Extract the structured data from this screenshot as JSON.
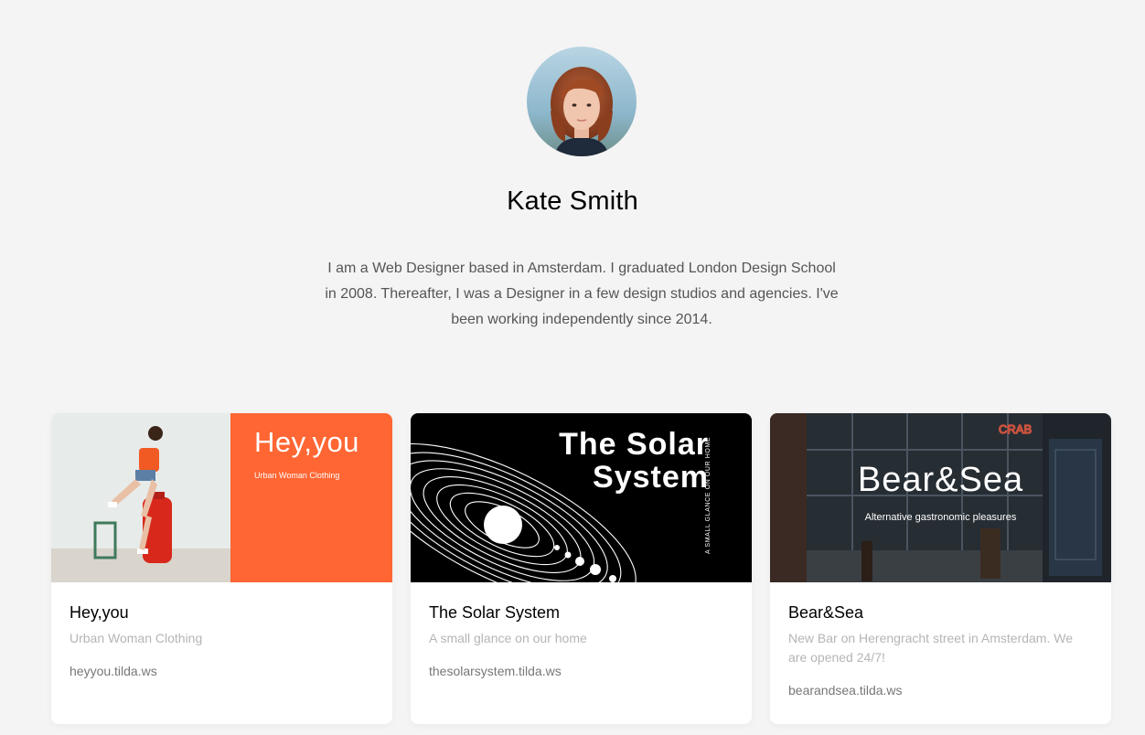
{
  "profile": {
    "name": "Kate Smith",
    "bio": "I am a Web Designer based in Amsterdam. I graduated London Design School in 2008. Thereafter, I was a Designer in a few design studios and agencies. I've been working independently since 2014.",
    "avatar_icon": "portrait-photo"
  },
  "projects": [
    {
      "cover_title": "Hey,you",
      "cover_subtitle": "Urban Woman Clothing",
      "title": "Hey,you",
      "description": "Urban Woman Clothing",
      "link": "heyyou.tilda.ws",
      "accent": "#ff6633"
    },
    {
      "cover_title": "The Solar System",
      "cover_vertical": "A SMALL GLANCE ON OUR HOME",
      "title": "The Solar System",
      "description": "A small glance on our home",
      "link": "thesolarsystem.tilda.ws",
      "accent": "#000000"
    },
    {
      "cover_title": "Bear&Sea",
      "cover_subtitle": "Alternative gastronomic pleasures",
      "title": "Bear&Sea",
      "description": "New Bar on Herengracht street in Amsterdam. We are opened 24/7!",
      "link": "bearandsea.tilda.ws",
      "accent": "#2a3038"
    }
  ]
}
